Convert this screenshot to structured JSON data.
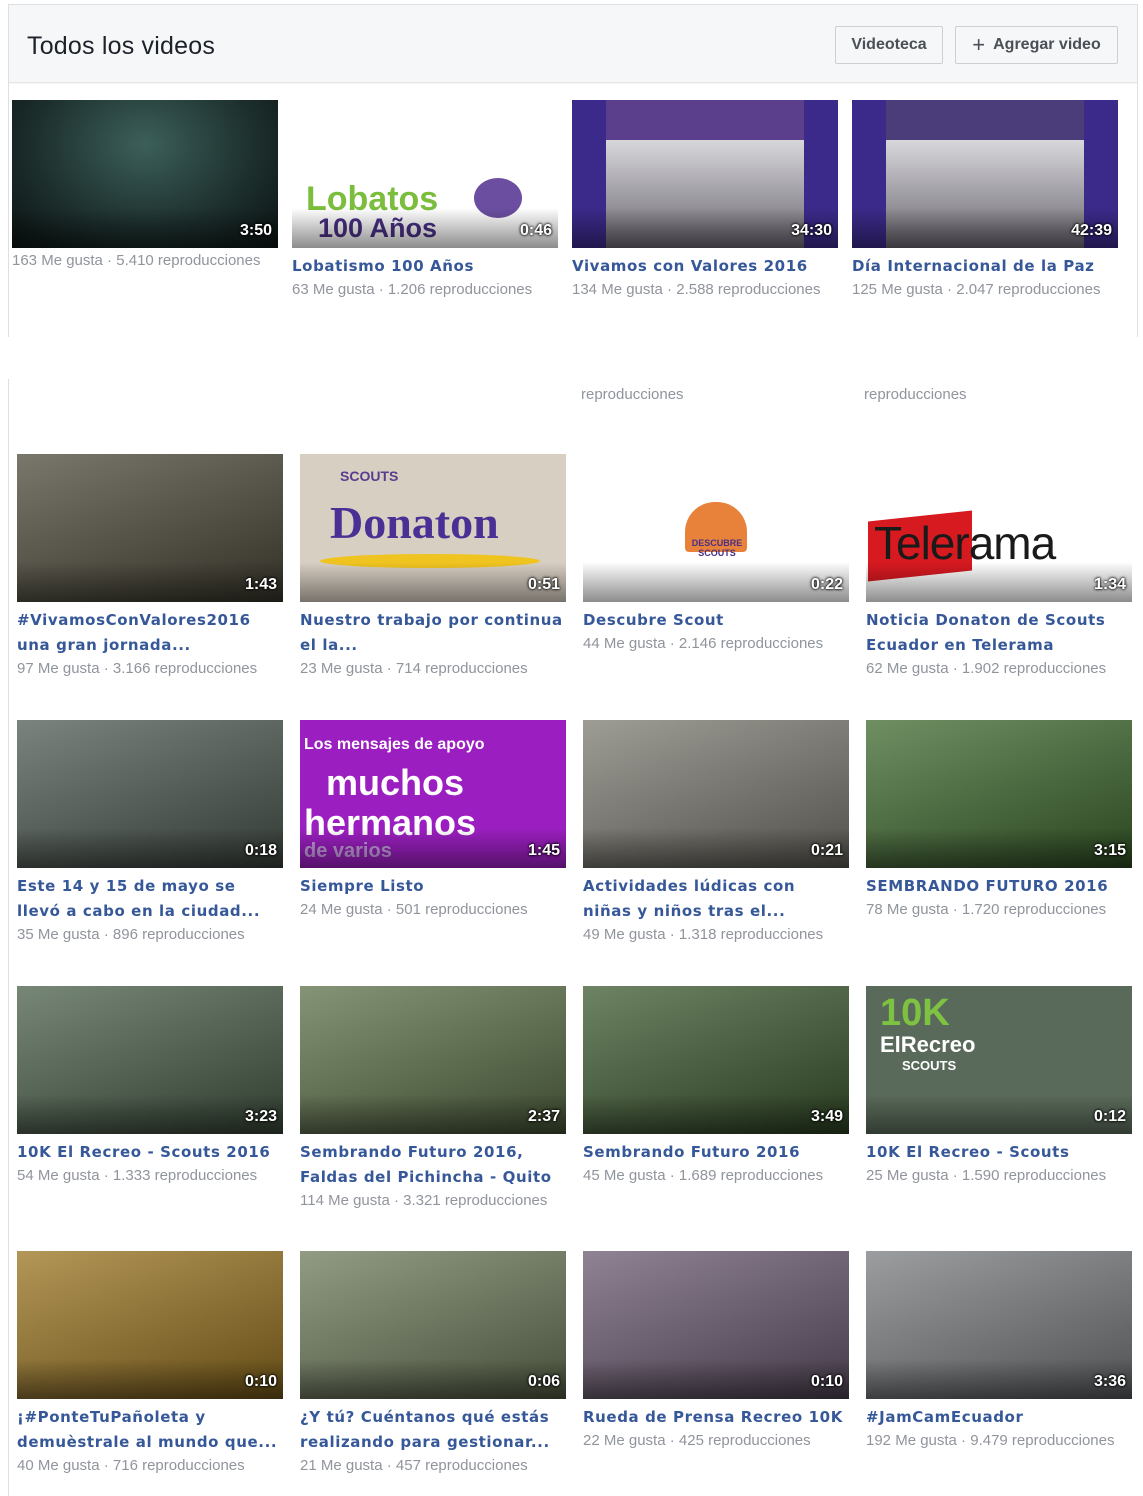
{
  "header": {
    "title": "Todos los videos",
    "videoteca_label": "Videoteca",
    "add_label": "Agregar video",
    "plus_icon": "+"
  },
  "top_row": [
    {
      "duration": "3:50",
      "title": "",
      "meta": "163 Me gusta · 5.410 reproducciones",
      "bg": "#1a2a2a"
    },
    {
      "duration": "0:46",
      "title": "Lobatismo 100 Años",
      "meta": "63 Me gusta · 1.206 reproducciones",
      "bg": "#ffffff",
      "thumb_text": "Lobatos",
      "thumb_text2": "100 Años"
    },
    {
      "duration": "34:30",
      "title": "Vivamos con Valores 2016",
      "meta": "134 Me gusta · 2.588 reproducciones",
      "bg": "#5b3f8c"
    },
    {
      "duration": "42:39",
      "title": "Día Internacional de la Paz",
      "meta": "125 Me gusta · 2.047 reproducciones",
      "bg": "#4a3d7a"
    }
  ],
  "cut_row": {
    "meta_2": "reproducciones",
    "meta_3": "reproducciones"
  },
  "grid": [
    {
      "duration": "1:43",
      "title": "#VivamosConValores2016 una gran jornada...",
      "meta": "97 Me gusta · 3.166 reproducciones",
      "bg": "#4d4a3a"
    },
    {
      "duration": "0:51",
      "title": "Nuestro trabajo por continua el la...",
      "meta": "23 Me gusta · 714 reproducciones",
      "bg": "#d8cfc3",
      "thumb_text": "Donaton",
      "thumb_small": "SCOUTS"
    },
    {
      "duration": "0:22",
      "title": "Descubre Scout",
      "meta": "44 Me gusta · 2.146 reproducciones",
      "bg": "#ffffff",
      "thumb_text": "DESCUBRE SCOUTS"
    },
    {
      "duration": "1:34",
      "title": "Noticia Donaton de Scouts Ecuador en Telerama",
      "meta": "62 Me gusta · 1.902 reproducciones",
      "bg": "#ffffff",
      "thumb_text": "Telerama"
    },
    {
      "duration": "0:18",
      "title": "Este 14 y 15 de mayo se llevó a cabo en la ciudad...",
      "meta": "35 Me gusta · 896 reproducciones",
      "bg": "#4e5a52"
    },
    {
      "duration": "1:45",
      "title": "Siempre Listo",
      "meta": "24 Me gusta · 501 reproducciones",
      "bg": "#9b1fc0",
      "thumb_text": "muchos",
      "thumb_text2": "hermanos",
      "thumb_small": "Los mensajes de apoyo",
      "thumb_small2": "de varios"
    },
    {
      "duration": "0:21",
      "title": "Actividades lúdicas con niñas y niños tras el...",
      "meta": "49 Me gusta · 1.318 reproducciones",
      "bg": "#7d7b72"
    },
    {
      "duration": "3:15",
      "title": "SEMBRANDO FUTURO 2016",
      "meta": "78 Me gusta · 1.720 reproducciones",
      "bg": "#3f6a2f"
    },
    {
      "duration": "3:23",
      "title": "10K El Recreo - Scouts 2016",
      "meta": "54 Me gusta · 1.333 reproducciones",
      "bg": "#4a5f4a"
    },
    {
      "duration": "2:37",
      "title": "Sembrando Futuro 2016, Faldas del Pichincha - Quito",
      "meta": "114 Me gusta · 3.321 reproducciones",
      "bg": "#5c7048"
    },
    {
      "duration": "3:49",
      "title": "Sembrando Futuro 2016",
      "meta": "45 Me gusta · 1.689 reproducciones",
      "bg": "#3d5a30"
    },
    {
      "duration": "0:12",
      "title": "10K El Recreo - Scouts",
      "meta": "25 Me gusta · 1.590 reproducciones",
      "bg": "#5a6a5a",
      "thumb_text": "10K",
      "thumb_text2": "ElRecreo",
      "thumb_small": "SCOUTS"
    },
    {
      "duration": "0:10",
      "title": "¡#PonteTuPañoleta y demuèstrale al mundo que...",
      "meta": "40 Me gusta · 716 reproducciones",
      "bg": "#9a7420"
    },
    {
      "duration": "0:06",
      "title": "¿Y tú? Cuéntanos qué estás realizando para gestionar...",
      "meta": "21 Me gusta · 457 reproducciones",
      "bg": "#6d7a5a"
    },
    {
      "duration": "0:10",
      "title": "Rueda de Prensa Recreo 10K",
      "meta": "22 Me gusta · 425 reproducciones",
      "bg": "#6a5a70"
    },
    {
      "duration": "3:36",
      "title": "#JamCamEcuador",
      "meta": "192 Me gusta · 9.479 reproducciones",
      "bg": "#7a7d80"
    }
  ]
}
